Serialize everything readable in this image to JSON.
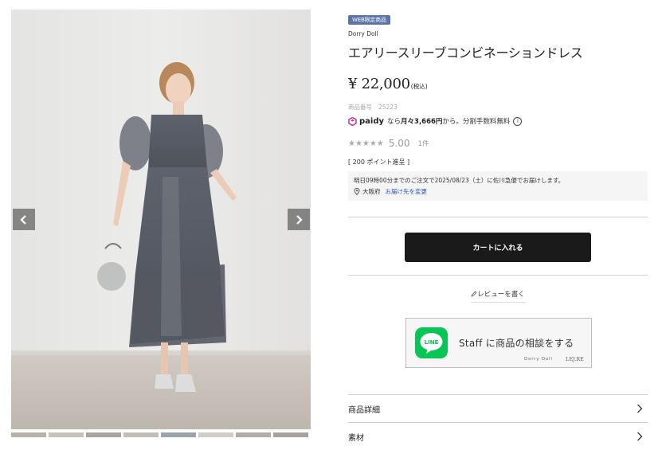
{
  "gallery": {
    "prev_icon": "chevron-left-icon",
    "next_icon": "chevron-right-icon",
    "thumbnail_count": 8
  },
  "product": {
    "badge": "WEB限定商品",
    "brand": "Dorry Doll",
    "title": "エアリースリーブコンビネーションドレス",
    "price": "¥ 22,000",
    "tax_note": "(税込)",
    "sku_label": "商品番号",
    "sku_value": "25223"
  },
  "paidy": {
    "logo_text": "paidy",
    "prefix": "なら",
    "monthly": "月々3,666円",
    "suffix": "から。分割手数料無料",
    "info_icon": "info-icon"
  },
  "rating": {
    "stars": "★★★★★",
    "value": "5.00",
    "count": "1件"
  },
  "points": "[ 200 ポイント進呈 ]",
  "delivery": {
    "message": "明日09時00分までのご注文で2025/08/23（土）に佐川急便でお届けします。",
    "location": "大阪府",
    "change_link": "お届け先を変更"
  },
  "actions": {
    "cart_label": "カートに入れる",
    "review_label": "レビューを書く"
  },
  "line_banner": {
    "logo_text": "LINE",
    "text": "Staff に商品の相談をする",
    "brand1": "Dorry Doll",
    "brand2": "LEJ.RE"
  },
  "accordion": {
    "details": "商品詳細",
    "material": "素材"
  },
  "colors": {
    "badge": "#5b74a9",
    "cart_button": "#1a1a1a",
    "line_green": "#06c755",
    "link": "#2b59c3"
  }
}
